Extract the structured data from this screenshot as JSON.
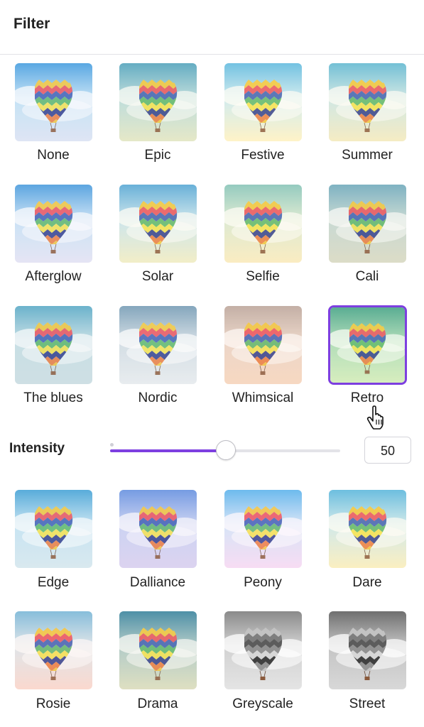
{
  "header": {
    "title": "Filter"
  },
  "filters": [
    {
      "label": "None",
      "sky1": "#3d9bdf",
      "sky2": "#bfe2f6",
      "ground": "#dfe6f4",
      "tint": "none"
    },
    {
      "label": "Epic",
      "sky1": "#4aa0c2",
      "sky2": "#b7dbe0",
      "ground": "#e6e8c8",
      "tint": "epic"
    },
    {
      "label": "Festive",
      "sky1": "#55b7e8",
      "sky2": "#c8eaf7",
      "ground": "#fff3c8",
      "tint": "festive"
    },
    {
      "label": "Summer",
      "sky1": "#57b6da",
      "sky2": "#c9e6ec",
      "ground": "#f6ecc4",
      "tint": "summer"
    },
    {
      "label": "Afterglow",
      "sky1": "#3f98dc",
      "sky2": "#c5e2f6",
      "ground": "#e6e5f5",
      "tint": "afterglow"
    },
    {
      "label": "Solar",
      "sky1": "#4aa3dc",
      "sky2": "#c5e4f4",
      "ground": "#f2eec8",
      "tint": "solar"
    },
    {
      "label": "Selfie",
      "sky1": "#7fc3bf",
      "sky2": "#d7ead6",
      "ground": "#fbecc2",
      "tint": "selfie"
    },
    {
      "label": "Cali",
      "sky1": "#6aa9c1",
      "sky2": "#c4d9d6",
      "ground": "#dcdcc7",
      "tint": "cali"
    },
    {
      "label": "The blues",
      "sky1": "#56a9c7",
      "sky2": "#c7e0e6",
      "ground": "#cfe0e4",
      "tint": "blues"
    },
    {
      "label": "Nordic",
      "sky1": "#6f97b2",
      "sky2": "#cfdae3",
      "ground": "#e8ecef",
      "tint": "nordic"
    },
    {
      "label": "Whimsical",
      "sky1": "#b8a7a0",
      "sky2": "#e9d6ca",
      "ground": "#f7d8c2",
      "tint": "whimsical"
    },
    {
      "label": "Retro",
      "sky1": "#3f9f8a",
      "sky2": "#a9d9b9",
      "ground": "#d7eebf",
      "tint": "retro",
      "selected": true
    },
    {
      "label": "Edge",
      "sky1": "#3d9fd6",
      "sky2": "#c4e3f3",
      "ground": "#d9e9f0",
      "tint": "edge"
    },
    {
      "label": "Dalliance",
      "sky1": "#5f90e0",
      "sky2": "#c8d3f3",
      "ground": "#dcd4f1",
      "tint": "dalliance"
    },
    {
      "label": "Peony",
      "sky1": "#4fb3ec",
      "sky2": "#d0e6f8",
      "ground": "#f7dcf3",
      "tint": "peony"
    },
    {
      "label": "Dare",
      "sky1": "#4fb4e6",
      "sky2": "#c9e9f3",
      "ground": "#fbefc1",
      "tint": "dare"
    },
    {
      "label": "Rosie",
      "sky1": "#6eb8de",
      "sky2": "#dbe8ef",
      "ground": "#fbd9cf",
      "tint": "rosie"
    },
    {
      "label": "Drama",
      "sky1": "#2f7fa1",
      "sky2": "#aac8c9",
      "ground": "#dfe0c2",
      "tint": "drama"
    },
    {
      "label": "Greyscale",
      "sky1": "#8a8a8a",
      "sky2": "#d2d2d2",
      "ground": "#e4e4e4",
      "tint": "grey"
    },
    {
      "label": "Street",
      "sky1": "#6f6f6f",
      "sky2": "#c4c4c4",
      "ground": "#d8d8d8",
      "tint": "grey"
    }
  ],
  "intensity": {
    "label": "Intensity",
    "value": "50",
    "fraction": 0.5
  },
  "colors": {
    "accent": "#7d3fe0",
    "track": "#e3e3e8"
  }
}
